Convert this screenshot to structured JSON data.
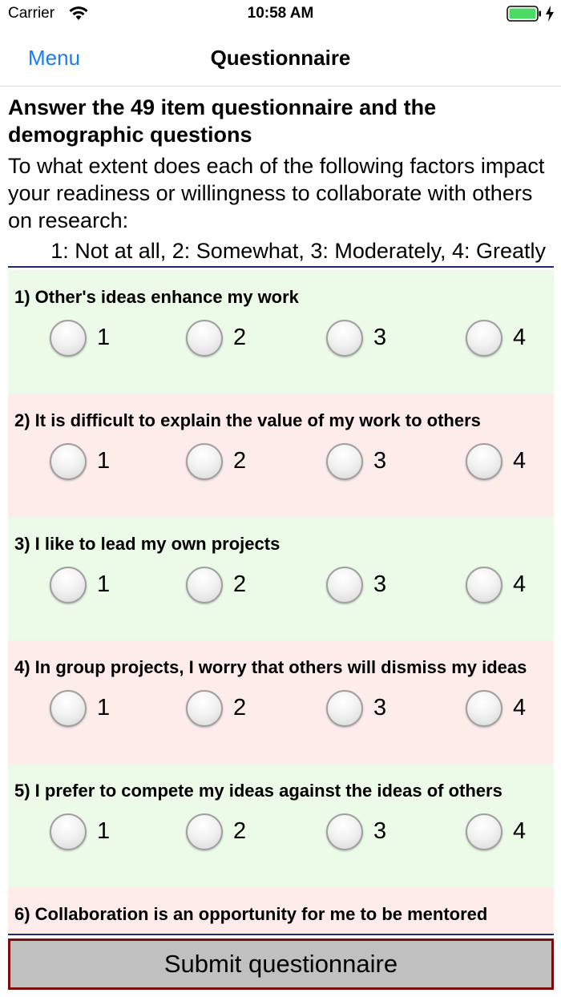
{
  "status_bar": {
    "carrier": "Carrier",
    "time": "10:58 AM",
    "battery_color": "#4cd964"
  },
  "nav": {
    "back_label": "Menu",
    "title": "Questionnaire",
    "accent": "#1a7cf0"
  },
  "intro": {
    "heading": "Answer the 49 item questionnaire and the demographic questions",
    "text": "To what extent does each of the following factors impact your readiness or willingness to collaborate with others on research:",
    "scale": "1: Not at all, 2: Somewhat, 3: Moderately, 4: Greatly"
  },
  "options": [
    "1",
    "2",
    "3",
    "4"
  ],
  "questions": [
    {
      "text": "1) Other's ideas enhance my work",
      "bg": "green"
    },
    {
      "text": "2) It is difficult to explain the value of my work to others",
      "bg": "pink"
    },
    {
      "text": "3) I like to lead my own projects",
      "bg": "green"
    },
    {
      "text": "4) In group projects, I worry that others will dismiss my ideas",
      "bg": "pink"
    },
    {
      "text": "5) I prefer to compete my ideas against the ideas of others",
      "bg": "green"
    },
    {
      "text": "6) Collaboration is an opportunity for me to be mentored",
      "bg": "pink"
    }
  ],
  "submit_label": "Submit questionnaire"
}
